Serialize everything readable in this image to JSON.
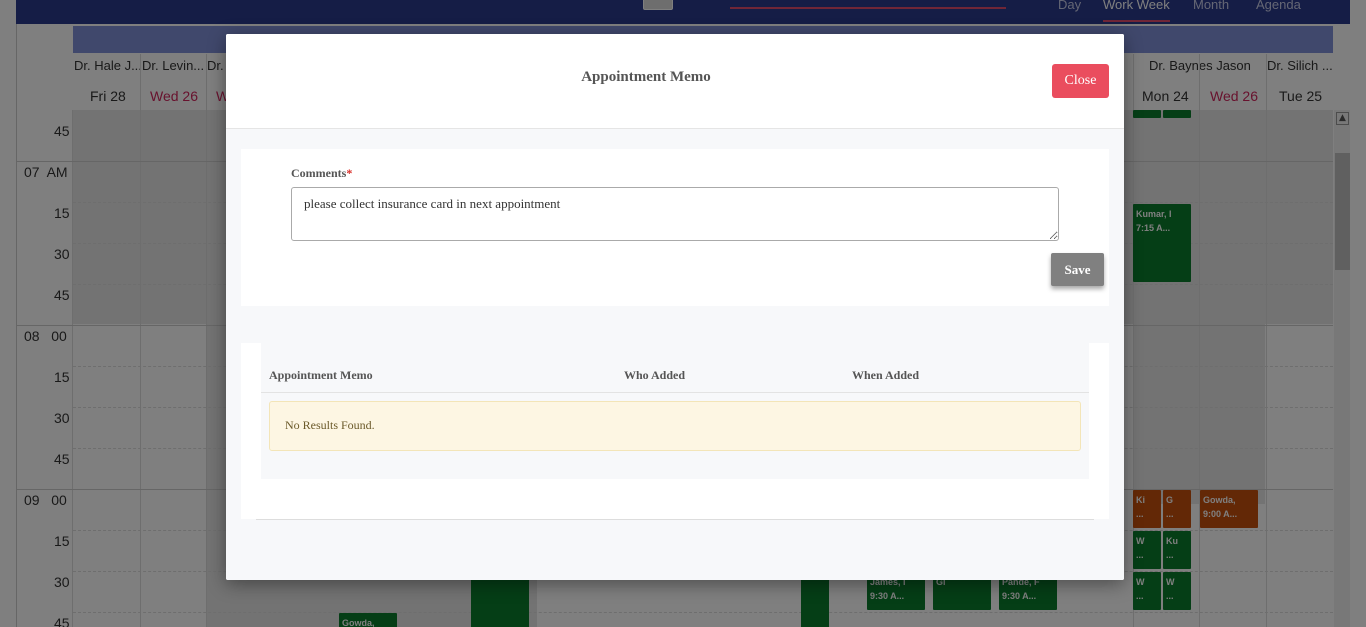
{
  "app": {
    "view_tabs": [
      "Day",
      "Work Week",
      "Month",
      "Agenda"
    ],
    "active_view": "Work Week"
  },
  "calendar": {
    "columns": [
      {
        "doctor": "Dr. Hale J...",
        "day": "Fri 28",
        "weekend": false
      },
      {
        "doctor": "Dr. Levin...",
        "day": "Wed 26",
        "weekend": true
      },
      {
        "doctor": "Dr.",
        "day": "W",
        "weekend": true
      },
      {
        "doctor": "Dr. Baynes Jason",
        "day": "Mon 24",
        "weekend": false
      },
      {
        "doctor": "",
        "day": "Wed 26",
        "weekend": true
      },
      {
        "doctor": "Dr. Silich ...",
        "day": "Tue 25",
        "weekend": false
      }
    ],
    "time_rows": [
      {
        "label": "45"
      },
      {
        "label": "07  AM"
      },
      {
        "label": "15"
      },
      {
        "label": "30"
      },
      {
        "label": "45"
      },
      {
        "label": "08   00"
      },
      {
        "label": "15"
      },
      {
        "label": "30"
      },
      {
        "label": "45"
      },
      {
        "label": "09   00"
      },
      {
        "label": "15"
      },
      {
        "label": "30"
      },
      {
        "label": "45"
      }
    ],
    "appointments": [
      {
        "name": "Kumar, I",
        "time": "7:15 A...",
        "color": "green"
      },
      {
        "name": "Ki",
        "time": "...",
        "color": "orange"
      },
      {
        "name": "G",
        "time": "...",
        "color": "orange"
      },
      {
        "name": "Gowda,",
        "time": "9:00 A...",
        "color": "orange"
      },
      {
        "name": "W",
        "time": "...",
        "color": "green"
      },
      {
        "name": "Ku",
        "time": "...",
        "color": "green"
      },
      {
        "name": "W",
        "time": "...",
        "color": "green"
      },
      {
        "name": "W",
        "time": "...",
        "color": "green"
      },
      {
        "name": "James, I",
        "time": "9:30 A...",
        "color": "green"
      },
      {
        "name": "Gi",
        "time": "",
        "color": "green"
      },
      {
        "name": "Pande, F",
        "time": "9:30 A...",
        "color": "green"
      },
      {
        "name": "Gowda,",
        "time": "",
        "color": "green"
      }
    ]
  },
  "modal": {
    "title": "Appointment Memo",
    "close_label": "Close",
    "comments_label": "Comments",
    "required_marker": "*",
    "comments_value": "please collect insurance card in next appointment",
    "save_label": "Save",
    "table": {
      "headers": [
        "Appointment Memo",
        "Who Added",
        "When Added"
      ],
      "rows": [],
      "empty_message": "No Results Found."
    }
  },
  "colors": {
    "topbar": "#2b3a8c",
    "close_button": "#ea4d5e",
    "save_button": "#808080",
    "appointment_green": "#0b7d2c",
    "appointment_orange": "#c6500c",
    "weekend_text": "#d0245c"
  }
}
